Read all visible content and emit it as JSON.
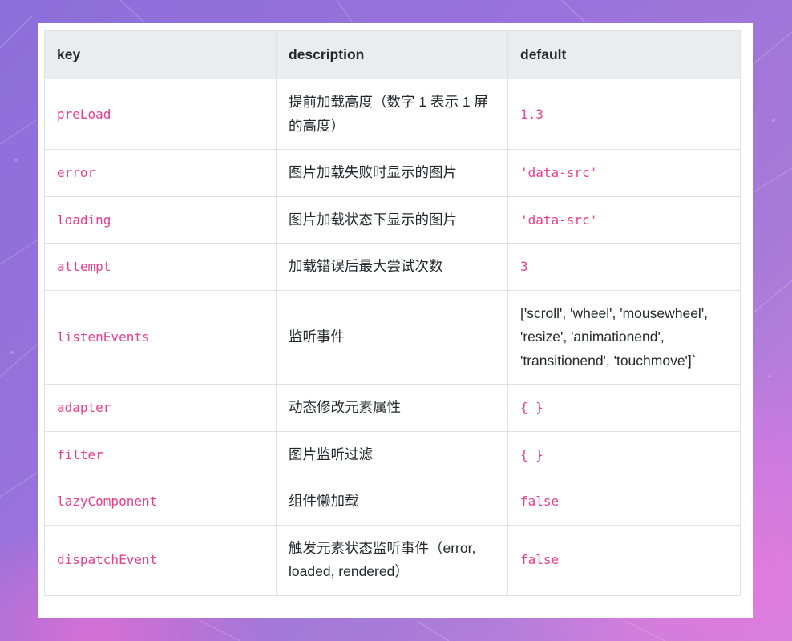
{
  "table": {
    "headers": [
      "key",
      "description",
      "default"
    ],
    "rows": [
      {
        "key": "preLoad",
        "description": "提前加载高度（数字 1 表示 1 屏的高度）",
        "default": "1.3",
        "default_is_code": true
      },
      {
        "key": "error",
        "description": "图片加载失败时显示的图片",
        "default": "'data-src'",
        "default_is_code": true
      },
      {
        "key": "loading",
        "description": "图片加载状态下显示的图片",
        "default": "'data-src'",
        "default_is_code": true
      },
      {
        "key": "attempt",
        "description": "加载错误后最大尝试次数",
        "default": "3",
        "default_is_code": true
      },
      {
        "key": "listenEvents",
        "description": "监听事件",
        "default": "['scroll', 'wheel', 'mousewheel', 'resize', 'animationend', 'transitionend', 'touchmove']`",
        "default_is_code": false
      },
      {
        "key": "adapter",
        "description": "动态修改元素属性",
        "default": "{ }",
        "default_is_code": true
      },
      {
        "key": "filter",
        "description": "图片监听过滤",
        "default": "{ }",
        "default_is_code": true
      },
      {
        "key": "lazyComponent",
        "description": "组件懒加载",
        "default": "false",
        "default_is_code": true
      },
      {
        "key": "dispatchEvent",
        "description": "触发元素状态监听事件（error, loaded, rendered）",
        "default": "false",
        "default_is_code": true
      }
    ]
  },
  "colors": {
    "code_text": "#e83e8c",
    "header_bg": "#eaecf0",
    "border": "#dfe2e5"
  }
}
